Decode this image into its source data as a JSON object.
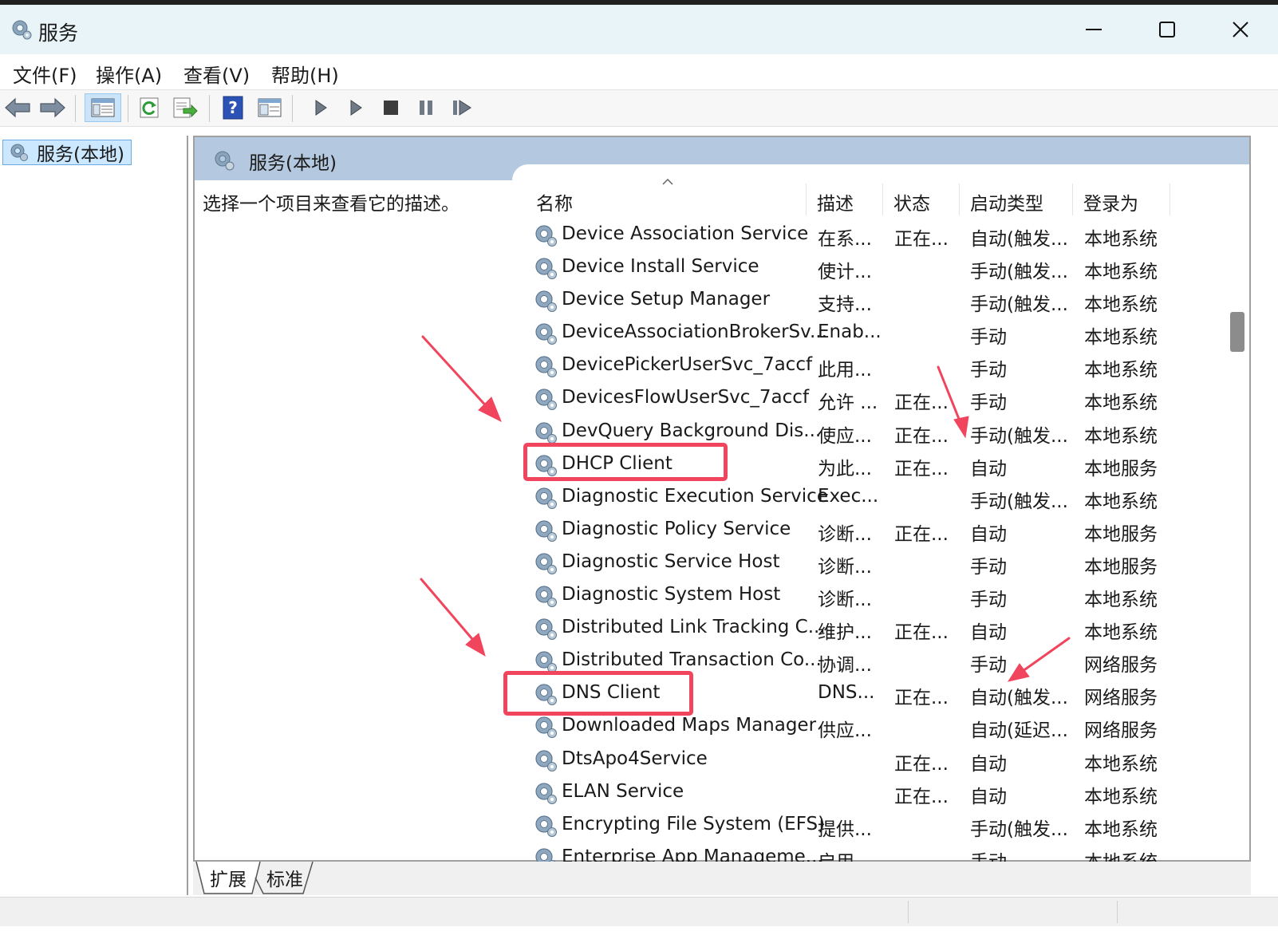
{
  "window": {
    "title": "服务",
    "icon": "services-gear-icon",
    "controls": [
      "minimize",
      "maximize",
      "close"
    ]
  },
  "menu": [
    "文件(F)",
    "操作(A)",
    "查看(V)",
    "帮助(H)"
  ],
  "toolbar_icons": [
    "back-arrow-icon",
    "forward-arrow-icon",
    "show-hide-console-tree-icon",
    "refresh-icon",
    "export-list-icon",
    "help-icon",
    "properties-icon",
    "start-service-icon",
    "start-service-alt-icon",
    "stop-service-icon",
    "pause-service-icon",
    "resume-service-icon"
  ],
  "tree": {
    "selected": "服务(本地)"
  },
  "panel": {
    "title": "服务(本地)",
    "description_hint": "选择一个项目来查看它的描述。"
  },
  "columns": {
    "name": "名称",
    "desc": "描述",
    "status": "状态",
    "startup": "启动类型",
    "logon": "登录为"
  },
  "services": [
    {
      "name": "Device Association Service",
      "desc": "在系...",
      "status": "正在...",
      "startup": "自动(触发...",
      "logon": "本地系统"
    },
    {
      "name": "Device Install Service",
      "desc": "使计...",
      "status": "",
      "startup": "手动(触发...",
      "logon": "本地系统"
    },
    {
      "name": "Device Setup Manager",
      "desc": "支持...",
      "status": "",
      "startup": "手动(触发...",
      "logon": "本地系统"
    },
    {
      "name": "DeviceAssociationBrokerSv...",
      "desc": "Enab...",
      "status": "",
      "startup": "手动",
      "logon": "本地系统"
    },
    {
      "name": "DevicePickerUserSvc_7accf",
      "desc": "此用...",
      "status": "",
      "startup": "手动",
      "logon": "本地系统"
    },
    {
      "name": "DevicesFlowUserSvc_7accf",
      "desc": "允许 ...",
      "status": "正在...",
      "startup": "手动",
      "logon": "本地系统"
    },
    {
      "name": "DevQuery Background Dis...",
      "desc": "使应...",
      "status": "正在...",
      "startup": "手动(触发...",
      "logon": "本地系统"
    },
    {
      "name": "DHCP Client",
      "desc": "为此...",
      "status": "正在...",
      "startup": "自动",
      "logon": "本地服务"
    },
    {
      "name": "Diagnostic Execution Service",
      "desc": "Exec...",
      "status": "",
      "startup": "手动(触发...",
      "logon": "本地系统"
    },
    {
      "name": "Diagnostic Policy Service",
      "desc": "诊断...",
      "status": "正在...",
      "startup": "自动",
      "logon": "本地服务"
    },
    {
      "name": "Diagnostic Service Host",
      "desc": "诊断...",
      "status": "",
      "startup": "手动",
      "logon": "本地服务"
    },
    {
      "name": "Diagnostic System Host",
      "desc": "诊断...",
      "status": "",
      "startup": "手动",
      "logon": "本地系统"
    },
    {
      "name": "Distributed Link Tracking C...",
      "desc": "维护...",
      "status": "正在...",
      "startup": "自动",
      "logon": "本地系统"
    },
    {
      "name": "Distributed Transaction Co...",
      "desc": "协调...",
      "status": "",
      "startup": "手动",
      "logon": "网络服务"
    },
    {
      "name": "DNS Client",
      "desc": "DNS...",
      "status": "正在...",
      "startup": "自动(触发...",
      "logon": "网络服务"
    },
    {
      "name": "Downloaded Maps Manager",
      "desc": "供应...",
      "status": "",
      "startup": "自动(延迟...",
      "logon": "网络服务"
    },
    {
      "name": "DtsApo4Service",
      "desc": "",
      "status": "正在...",
      "startup": "自动",
      "logon": "本地系统"
    },
    {
      "name": "ELAN Service",
      "desc": "",
      "status": "正在...",
      "startup": "自动",
      "logon": "本地系统"
    },
    {
      "name": "Encrypting File System (EFS)",
      "desc": "提供...",
      "status": "",
      "startup": "手动(触发...",
      "logon": "本地系统"
    },
    {
      "name": "Enterprise App Manageme...",
      "desc": "启用...",
      "status": "",
      "startup": "手动",
      "logon": "本地系统"
    }
  ],
  "tabs": [
    "扩展",
    "标准"
  ],
  "colors": {
    "annotation": "#f0455d",
    "panel_header": "#b4c8df",
    "tree_selection": "#cce8ff",
    "titlebar": "#e9f4f8"
  }
}
